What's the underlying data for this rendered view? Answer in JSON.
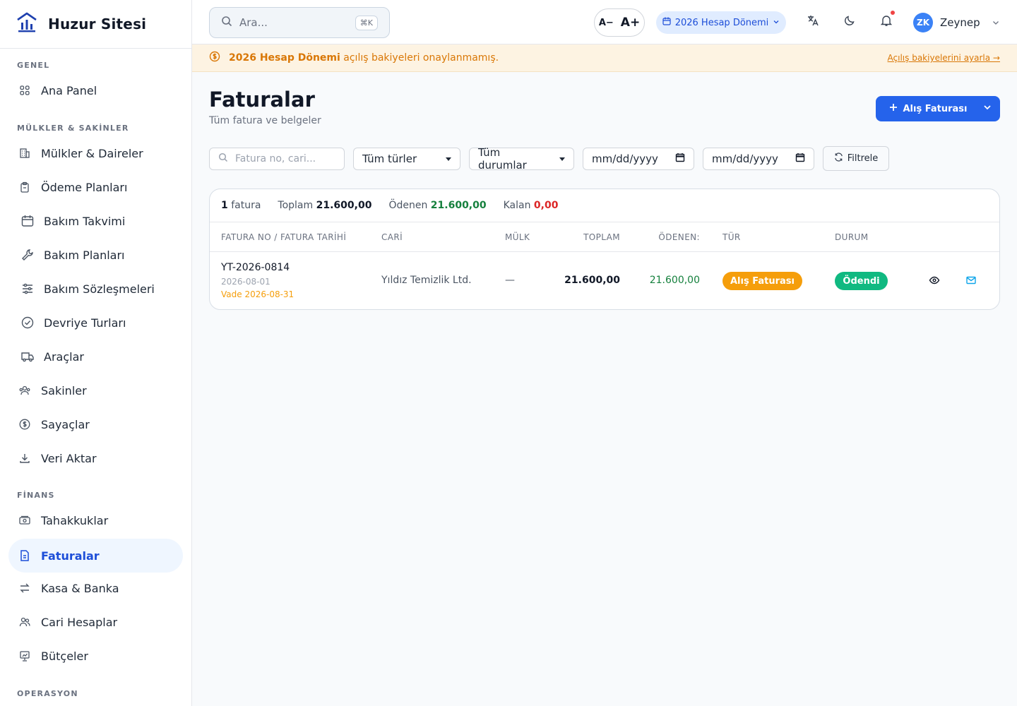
{
  "brand": {
    "name": "Huzur Sitesi",
    "logo_icon": "building-chart-icon"
  },
  "sidebar": {
    "sections": [
      {
        "label": "GENEL"
      },
      {
        "label": "MÜLKLER & SAKİNLER"
      },
      {
        "label": "FİNANS"
      },
      {
        "label": "OPERASYON"
      }
    ],
    "items": [
      {
        "label": "Ana Panel",
        "icon": "grid-icon"
      },
      {
        "label": "Mülkler & Daireler",
        "icon": "building-icon"
      },
      {
        "label": "Ödeme Planları",
        "icon": "clipboard-icon"
      },
      {
        "label": "Bakım Takvimi",
        "icon": "calendar-icon"
      },
      {
        "label": "Bakım Planları",
        "icon": "wrench-icon"
      },
      {
        "label": "Bakım Sözleşmeleri",
        "icon": "sliders-icon"
      },
      {
        "label": "Devriye Turları",
        "icon": "check-circle-icon"
      },
      {
        "label": "Araçlar",
        "icon": "truck-icon"
      },
      {
        "label": "Sakinler",
        "icon": "users-icon"
      },
      {
        "label": "Sayaçlar",
        "icon": "dollar-circle-icon"
      },
      {
        "label": "Veri Aktar",
        "icon": "download-icon"
      },
      {
        "label": "Tahakkuklar",
        "icon": "banknote-icon"
      },
      {
        "label": "Faturalar",
        "icon": "file-invoice-icon",
        "active": true
      },
      {
        "label": "Kasa & Banka",
        "icon": "arrows-exchange-icon"
      },
      {
        "label": "Cari Hesaplar",
        "icon": "user-group-icon"
      },
      {
        "label": "Bütçeler",
        "icon": "presentation-icon"
      }
    ]
  },
  "header": {
    "search_placeholder": "Ara...",
    "search_shortcut": "⌘K",
    "font_decrease": "A−",
    "font_increase": "A+",
    "period": "2026 Hesap Dönemi",
    "user_initials": "ZK",
    "user_name": "Zeynep"
  },
  "banner": {
    "bold": "2026 Hesap Dönemi",
    "text": "açılış bakiyeleri onaylanmamış.",
    "link": "Açılış bakiyelerini ayarla →"
  },
  "page": {
    "title": "Faturalar",
    "subtitle": "Tüm fatura ve belgeler",
    "primary_button": "Alış Faturası"
  },
  "filters": {
    "search_placeholder": "Fatura no, cari...",
    "type_select": "Tüm türler",
    "status_select": "Tüm durumlar",
    "date_from_placeholder": "mm/dd/yyyy",
    "date_to_placeholder": "mm/dd/yyyy",
    "filter_button": "Filtrele"
  },
  "summary": {
    "count": "1",
    "count_label": "fatura",
    "total_label": "Toplam",
    "total": "21.600,00",
    "paid_label": "Ödenen",
    "paid": "21.600,00",
    "remaining_label": "Kalan",
    "remaining": "0,00"
  },
  "table": {
    "columns": [
      "FATURA NO / FATURA TARİHİ",
      "CARİ",
      "MÜLK",
      "TOPLAM",
      "ÖDENEN:",
      "TÜR",
      "DURUM"
    ],
    "rows": [
      {
        "invoice_no": "YT-2026-0814",
        "date": "2026-08-01",
        "due": "Vade 2026-08-31",
        "party": "Yıldız Temizlik Ltd.",
        "property": "—",
        "total": "21.600,00",
        "paid": "21.600,00",
        "type": "Alış Faturası",
        "status": "Ödendi"
      }
    ]
  },
  "colors": {
    "accent": "#2563eb",
    "type_badge": "#f59e0b",
    "status_badge": "#10b981",
    "banner_text": "#d97706"
  }
}
